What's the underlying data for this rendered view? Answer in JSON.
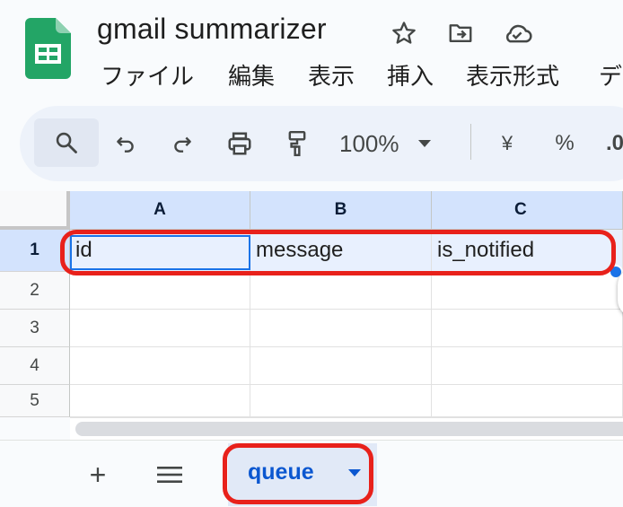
{
  "document": {
    "title": "gmail summarizer",
    "icons": [
      "sheets-logo-icon",
      "star-icon",
      "move-folder-icon",
      "cloud-status-icon"
    ]
  },
  "menu": [
    "ファイル",
    "編集",
    "表示",
    "挿入",
    "表示形式",
    "デ"
  ],
  "toolbar": {
    "zoom": "100%",
    "currency_label": "¥",
    "percent_label": "%",
    "decimal_label": ".0",
    "icons": [
      "search-icon",
      "undo-icon",
      "redo-icon",
      "print-icon",
      "paint-format-icon",
      "chevron-down-icon"
    ]
  },
  "grid": {
    "columns": [
      "A",
      "B",
      "C"
    ],
    "rows": [
      "1",
      "2",
      "3",
      "4",
      "5"
    ],
    "cells": [
      [
        "id",
        "message",
        "is_notified"
      ],
      [
        "",
        "",
        ""
      ],
      [
        "",
        "",
        ""
      ],
      [
        "",
        "",
        ""
      ],
      [
        "",
        "",
        ""
      ]
    ],
    "selected_cell": "A1"
  },
  "sheets": {
    "add_label": "+",
    "tabs": [
      {
        "label": "queue",
        "active": true
      }
    ]
  },
  "colors": {
    "accent": "#0b57d0",
    "selection": "#d3e3fd",
    "annotation": "#e8211b"
  }
}
